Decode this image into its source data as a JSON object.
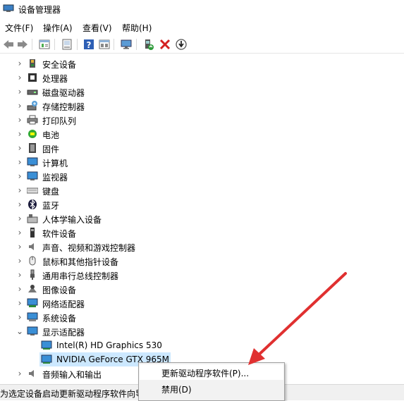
{
  "window": {
    "title": "设备管理器"
  },
  "menu": {
    "file": "文件(F)",
    "action": "操作(A)",
    "view": "查看(V)",
    "help": "帮助(H)"
  },
  "toolbar": {
    "icons": [
      "back-arrow-icon",
      "forward-arrow-icon",
      "properties-icon",
      "computer-view-icon",
      "help-icon",
      "device-view-icon",
      "monitor-scan-icon",
      "enable-device-icon",
      "uninstall-x-icon",
      "update-driver-icon"
    ]
  },
  "tree": {
    "items": [
      {
        "label": "安全设备",
        "expanded": false,
        "icon": "security-device-icon"
      },
      {
        "label": "处理器",
        "expanded": false,
        "icon": "processor-icon"
      },
      {
        "label": "磁盘驱动器",
        "expanded": false,
        "icon": "disk-drive-icon"
      },
      {
        "label": "存储控制器",
        "expanded": false,
        "icon": "storage-controller-icon"
      },
      {
        "label": "打印队列",
        "expanded": false,
        "icon": "printer-icon"
      },
      {
        "label": "电池",
        "expanded": false,
        "icon": "battery-icon"
      },
      {
        "label": "固件",
        "expanded": false,
        "icon": "firmware-icon"
      },
      {
        "label": "计算机",
        "expanded": false,
        "icon": "computer-icon"
      },
      {
        "label": "监视器",
        "expanded": false,
        "icon": "monitor-icon"
      },
      {
        "label": "键盘",
        "expanded": false,
        "icon": "keyboard-icon"
      },
      {
        "label": "蓝牙",
        "expanded": false,
        "icon": "bluetooth-icon"
      },
      {
        "label": "人体学输入设备",
        "expanded": false,
        "icon": "hid-icon"
      },
      {
        "label": "软件设备",
        "expanded": false,
        "icon": "software-device-icon"
      },
      {
        "label": "声音、视频和游戏控制器",
        "expanded": false,
        "icon": "sound-icon"
      },
      {
        "label": "鼠标和其他指针设备",
        "expanded": false,
        "icon": "mouse-icon"
      },
      {
        "label": "通用串行总线控制器",
        "expanded": false,
        "icon": "usb-icon"
      },
      {
        "label": "图像设备",
        "expanded": false,
        "icon": "camera-icon"
      },
      {
        "label": "网络适配器",
        "expanded": false,
        "icon": "network-adapter-icon"
      },
      {
        "label": "系统设备",
        "expanded": false,
        "icon": "system-device-icon"
      },
      {
        "label": "显示适配器",
        "expanded": true,
        "icon": "display-adapter-icon"
      }
    ],
    "display_children": [
      {
        "label": "Intel(R) HD Graphics 530"
      },
      {
        "label": "NVIDIA GeForce GTX 965M",
        "selected": true
      }
    ],
    "after": [
      {
        "label": "音频输入和输出",
        "expanded": false,
        "icon": "audio-io-icon"
      }
    ]
  },
  "context_menu": {
    "items": [
      {
        "label": "更新驱动程序软件(P)...",
        "highlighted": true
      },
      {
        "label": "禁用(D)"
      }
    ]
  },
  "status": {
    "text": "为选定设备启动更新驱动程序软件向导。"
  },
  "colors": {
    "selection": "#cce8ff",
    "arrow": "#e03030",
    "accent": "#1e6fc4"
  }
}
